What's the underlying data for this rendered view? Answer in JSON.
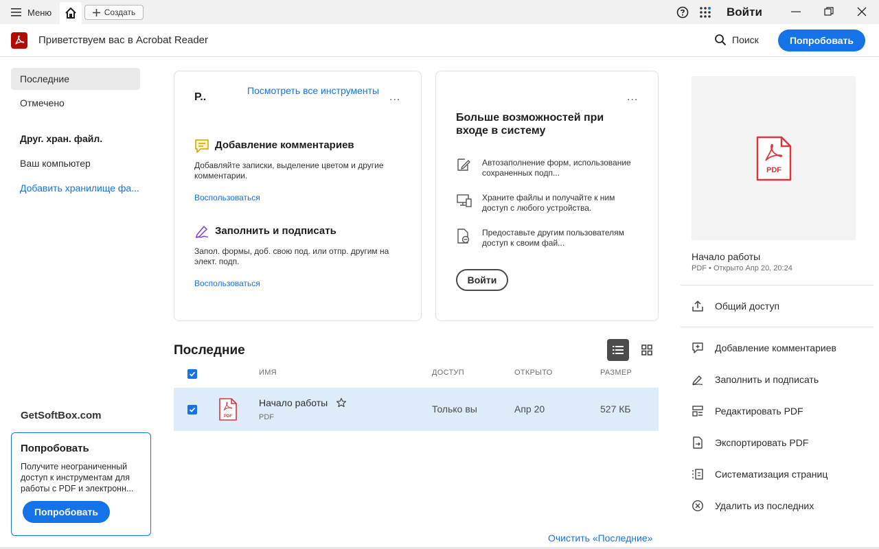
{
  "titlebar": {
    "menu_label": "Меню",
    "create_label": "Создать",
    "signin_label": "Войти"
  },
  "header": {
    "welcome": "Приветствуем вас в Acrobat Reader",
    "search_label": "Поиск",
    "try_label": "Попробовать"
  },
  "sidebar": {
    "items": [
      {
        "label": "Последние"
      },
      {
        "label": "Отмечено"
      }
    ],
    "section_title": "Друг. хран. файл.",
    "computer_label": "Ваш компьютер",
    "add_storage_label": "Добавить хранилище фа...",
    "brand": "GetSoftBox.com",
    "promo": {
      "title": "Попробовать",
      "description": "Получите неограниченный доступ к инструментам для работы с PDF и электронн...",
      "button": "Попробовать"
    }
  },
  "tools_card": {
    "title": "Р..",
    "see_all": "Посмотреть все инструменты",
    "more": "...",
    "tools": [
      {
        "title": "Добавление комментариев",
        "description": "Добавляйте записки, выделение цветом и другие комментарии.",
        "link": "Воспользоваться"
      },
      {
        "title": "Заполнить и подписать",
        "description": "Запол. формы, доб. свою под. или отпр. другим на элект. подп.",
        "link": "Воспользоваться"
      }
    ]
  },
  "signin_card": {
    "title": "Больше возможностей при входе в систему",
    "more": "...",
    "features": [
      {
        "text": "Автозаполнение форм, использование сохраненных подп..."
      },
      {
        "text": "Храните файлы и получайте к ним доступ с любого устройства."
      },
      {
        "text": "Предоставьте другим пользователям доступ к своим фай..."
      }
    ],
    "button": "Войти"
  },
  "recent": {
    "title": "Последние",
    "columns": {
      "name": "ИМЯ",
      "access": "ДОСТУП",
      "opened": "ОТКРЫТО",
      "size": "РАЗМЕР"
    },
    "rows": [
      {
        "name": "Начало работы",
        "type": "PDF",
        "access": "Только вы",
        "opened": "Апр 20",
        "size": "527 КБ"
      }
    ],
    "clear_label": "Очистить «Последние»"
  },
  "details": {
    "pdf_badge": "PDF",
    "file_name": "Начало работы",
    "file_meta": "PDF  •  Открыто Апр 20, 20:24",
    "actions": [
      {
        "label": "Общий доступ",
        "icon": "share-icon"
      },
      {
        "label": "Добавление комментариев",
        "icon": "comment-icon"
      },
      {
        "label": "Заполнить и подписать",
        "icon": "sign-icon"
      },
      {
        "label": "Редактировать PDF",
        "icon": "edit-pdf-icon"
      },
      {
        "label": "Экспортировать PDF",
        "icon": "export-pdf-icon"
      },
      {
        "label": "Систематизация страниц",
        "icon": "organize-pages-icon"
      },
      {
        "label": "Удалить из последних",
        "icon": "remove-icon"
      }
    ]
  },
  "colors": {
    "accent": "#1473e6",
    "acrobat_red": "#b30b00",
    "selected_row": "#deebf9"
  }
}
